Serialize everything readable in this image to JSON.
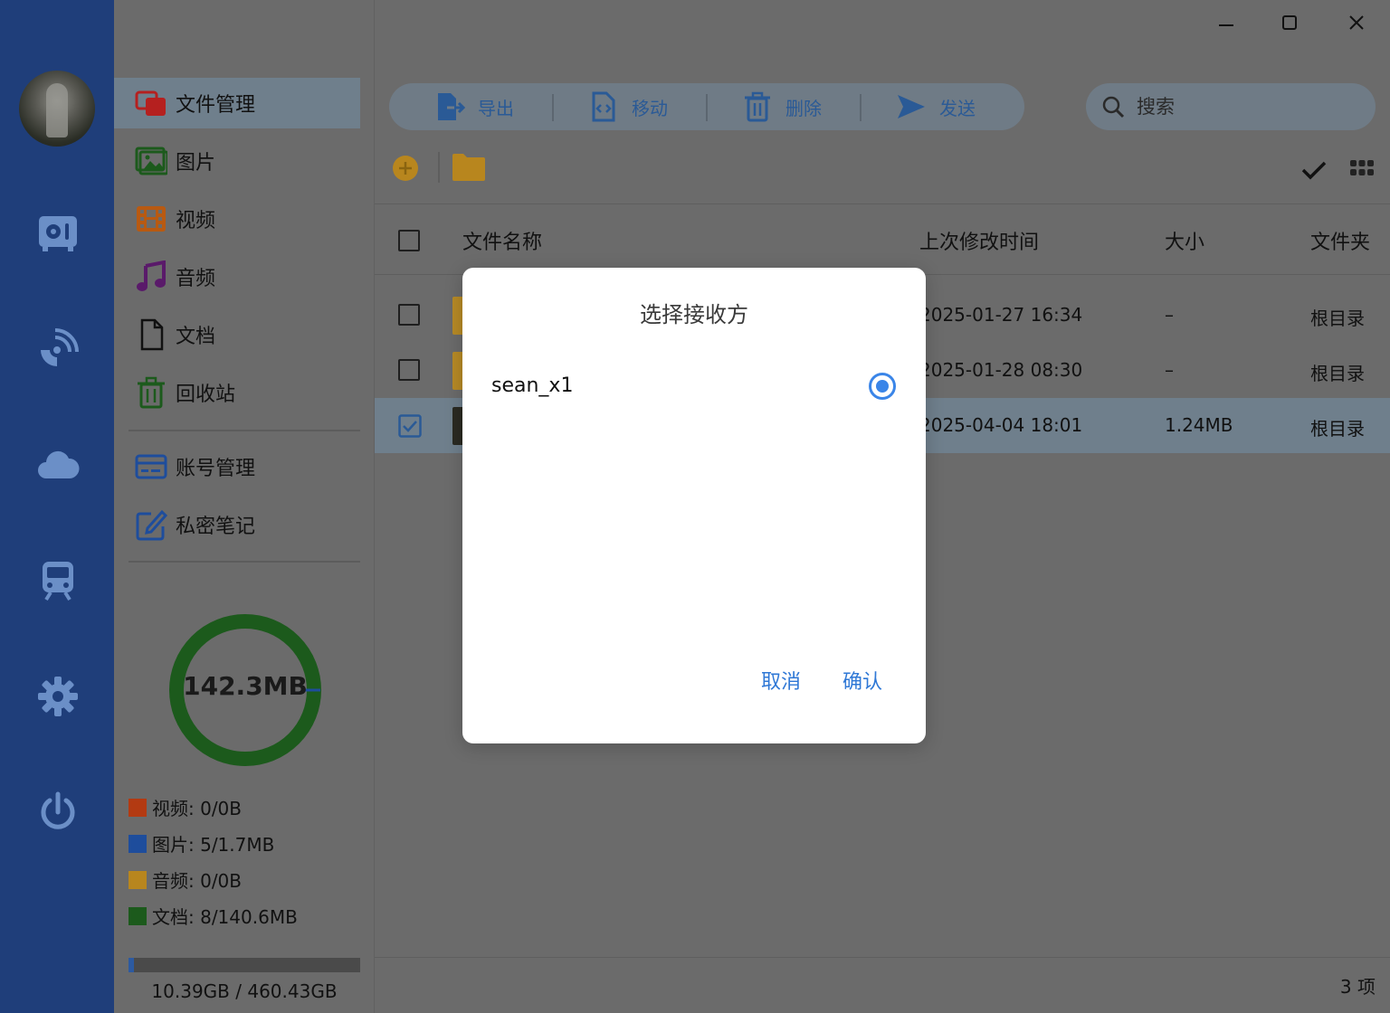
{
  "app": {
    "window_controls": {
      "minimize": "—",
      "maximize": "☐",
      "close": "✕"
    }
  },
  "rail": {
    "icons": [
      "drive-icon",
      "satellite-icon",
      "cloud-icon",
      "train-icon",
      "gear-icon",
      "power-icon"
    ]
  },
  "sidebar": {
    "items": [
      {
        "label": "文件管理",
        "icon": "file-manager-icon",
        "active": true
      },
      {
        "label": "图片",
        "icon": "image-icon"
      },
      {
        "label": "视频",
        "icon": "video-icon"
      },
      {
        "label": "音频",
        "icon": "music-icon"
      },
      {
        "label": "文档",
        "icon": "document-icon"
      },
      {
        "label": "回收站",
        "icon": "trash-icon"
      }
    ],
    "items2": [
      {
        "label": "账号管理",
        "icon": "account-icon"
      },
      {
        "label": "私密笔记",
        "icon": "note-icon"
      }
    ],
    "usage": {
      "total_label": "142.3MB",
      "legend": [
        {
          "label": "视频: 0/0B",
          "color": "#b33a12"
        },
        {
          "label": "图片: 5/1.7MB",
          "color": "#1e4d9c"
        },
        {
          "label": "音频: 0/0B",
          "color": "#b8861e"
        },
        {
          "label": "文档: 8/140.6MB",
          "color": "#1c5a1c"
        }
      ]
    },
    "storage": {
      "text": "10.39GB / 460.43GB",
      "fraction": 0.0226
    }
  },
  "toolbar": {
    "export_label": "导出",
    "move_label": "移动",
    "delete_label": "删除",
    "send_label": "发送"
  },
  "search": {
    "placeholder": "搜索"
  },
  "table": {
    "headers": {
      "name": "文件名称",
      "modified": "上次修改时间",
      "size": "大小",
      "folder": "文件夹"
    },
    "rows": [
      {
        "modified": "2025-01-27 16:34",
        "size": "–",
        "folder": "根目录",
        "checked": false
      },
      {
        "modified": "2025-01-28 08:30",
        "size": "–",
        "folder": "根目录",
        "checked": false
      },
      {
        "modified": "2025-04-04 18:01",
        "size": "1.24MB",
        "folder": "根目录",
        "checked": true
      }
    ]
  },
  "footer": {
    "count": "3 项"
  },
  "dialog": {
    "title": "选择接收方",
    "option_label": "sean_x1",
    "cancel": "取消",
    "confirm": "确认"
  },
  "colors": {
    "rail": "#1f3e7a",
    "accent": "#3a85e8",
    "donut": "#1c5a1c"
  }
}
